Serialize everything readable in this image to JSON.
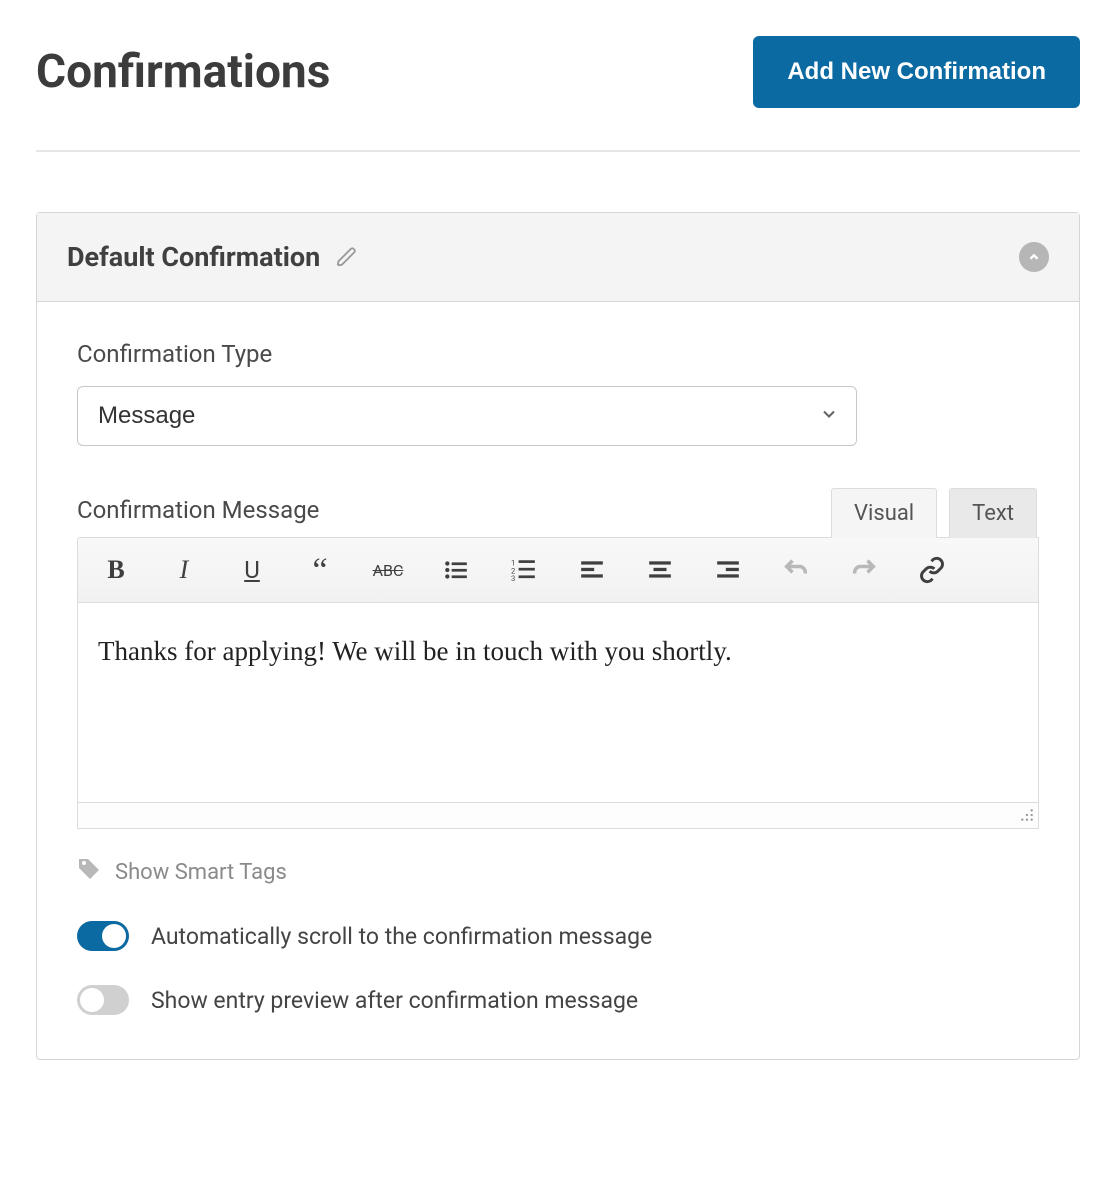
{
  "header": {
    "title": "Confirmations",
    "add_button": "Add New Confirmation"
  },
  "panel": {
    "title": "Default Confirmation"
  },
  "form": {
    "type_label": "Confirmation Type",
    "type_value": "Message",
    "message_label": "Confirmation Message",
    "message_value": "Thanks for applying! We will be in touch with you shortly."
  },
  "tabs": {
    "visual": "Visual",
    "text": "Text"
  },
  "smart_tags_label": "Show Smart Tags",
  "toggles": {
    "scroll": {
      "label": "Automatically scroll to the confirmation message",
      "on": true
    },
    "preview": {
      "label": "Show entry preview after confirmation message",
      "on": false
    }
  }
}
